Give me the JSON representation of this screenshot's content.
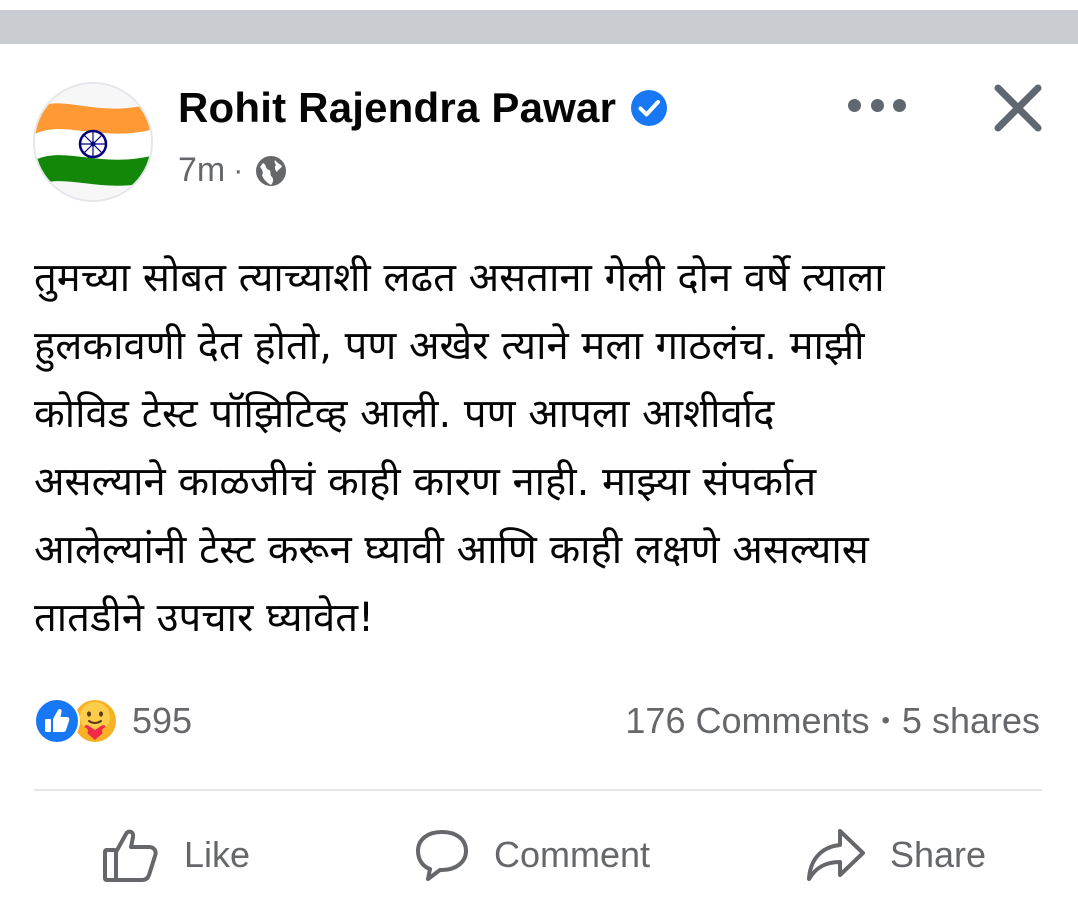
{
  "post": {
    "author": "Rohit Rajendra Pawar",
    "time": "7m",
    "separator": "·",
    "text": "तुमच्या सोबत त्याच्याशी लढत असताना गेली दोन वर्षे त्याला\nहुलकावणी देत होतो, पण अखेर त्याने मला गाठलंच. माझी\nकोविड टेस्ट पॉझिटिव्ह आली. पण आपला आशीर्वाद\nअसल्याने काळजीचं काही कारण नाही. माझ्या संपर्कात\nआलेल्यांनी टेस्ट करून घ्यावी आणि काही लक्षणे असल्यास\nतातडीने उपचार घ्यावेत!",
    "reaction_count": "595",
    "comments": "176 Comments",
    "stats_bullet": "•",
    "shares": "5 shares"
  },
  "actions": {
    "like": "Like",
    "comment": "Comment",
    "share": "Share"
  },
  "icons": {
    "verified": "verified-badge-icon",
    "audience": "globe-icon",
    "more": "more-options-icon",
    "close": "close-icon",
    "like_reaction": "like-reaction-icon",
    "care_reaction": "care-reaction-icon"
  },
  "colors": {
    "accent": "#1877f2",
    "secondary_text": "#65676b",
    "primary_text": "#050505"
  }
}
